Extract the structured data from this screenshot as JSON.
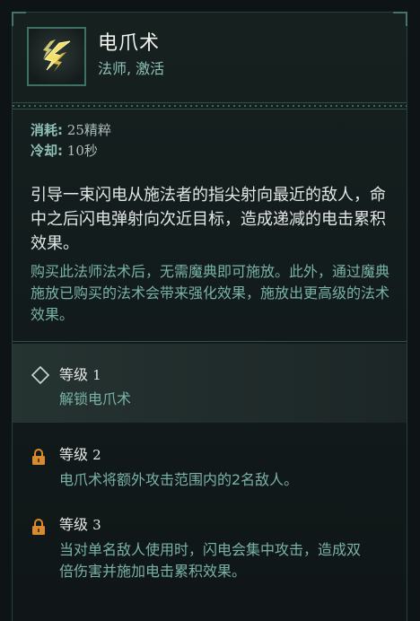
{
  "skill": {
    "name": "电爪术",
    "tags": "法师, 激活"
  },
  "stats": {
    "cost_label": "消耗:",
    "cost_value": "25精粹",
    "cooldown_label": "冷却:",
    "cooldown_value": "10秒"
  },
  "description": "引导一束闪电从施法者的指尖射向最近的敌人，命中之后闪电弹射向次近目标，造成递减的电击累积效果。",
  "note": "购买此法师法术后，无需魔典即可施放。此外，通过魔典施放已购买的法术会带来强化效果，施放出更高级的法术效果。",
  "levels": [
    {
      "label": "等级",
      "number": "1",
      "text": "解锁电爪术",
      "icon": "diamond-icon",
      "state": "current"
    },
    {
      "label": "等级",
      "number": "2",
      "text": "电爪术将额外攻击范围内的2名敌人。",
      "icon": "lock-icon",
      "state": "locked"
    },
    {
      "label": "等级",
      "number": "3",
      "text": "当对单名敌人使用时，闪电会集中攻击，造成双倍伤害并施加电击累积效果。",
      "icon": "lock-icon",
      "state": "locked"
    }
  ],
  "colors": {
    "accent": "#8fc0b7",
    "lock": "#d88a2e",
    "lightning": "#f2e06a"
  }
}
